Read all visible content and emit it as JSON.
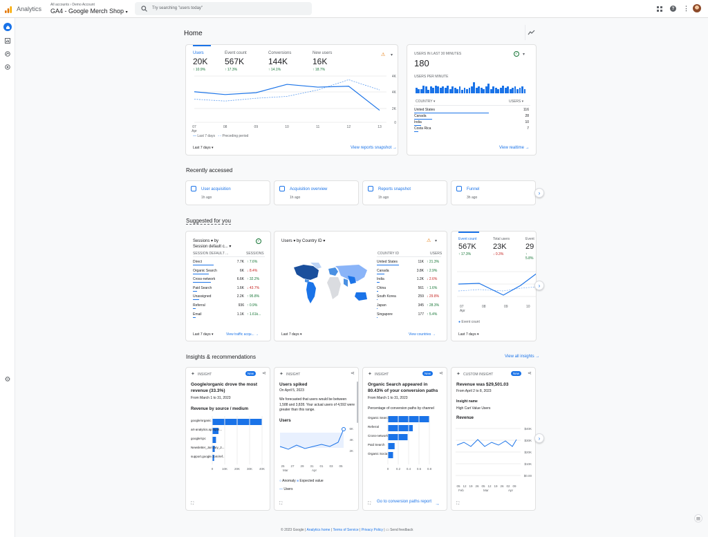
{
  "header": {
    "app": "Analytics",
    "breadcrumb": "All accounts › Demo Account",
    "property": "GA4 - Google Merch Shop",
    "search_placeholder": "Try searching \"users today\""
  },
  "page_title": "Home",
  "summary": {
    "metrics": [
      {
        "label": "Users",
        "value": "20K",
        "delta": "↑ 10.9%"
      },
      {
        "label": "Event count",
        "value": "567K",
        "delta": "↑ 17.3%"
      },
      {
        "label": "Conversions",
        "value": "144K",
        "delta": "↑ 14.1%"
      },
      {
        "label": "New users",
        "value": "16K",
        "delta": "↑ 18.7%"
      }
    ],
    "yticks": [
      "4K",
      "4K",
      "2K",
      "0"
    ],
    "xticks": [
      "07",
      "08",
      "09",
      "10",
      "11",
      "12",
      "13"
    ],
    "xsub": "Apr",
    "legend_current": "Last 7 days",
    "legend_previous": "Preceding period",
    "range": "Last 7 days",
    "link": "View reports snapshot",
    "chart_data": {
      "type": "line",
      "categories": [
        "07",
        "08",
        "09",
        "10",
        "11",
        "12",
        "13"
      ],
      "series": [
        {
          "name": "Last 7 days",
          "values": [
            3.3,
            3.0,
            3.2,
            4.1,
            3.8,
            3.9,
            1.3
          ]
        },
        {
          "name": "Preceding period",
          "values": [
            2.5,
            2.3,
            2.6,
            2.8,
            3.5,
            4.6,
            3.5
          ]
        }
      ],
      "ylim": [
        0,
        5
      ]
    }
  },
  "realtime": {
    "title": "USERS IN LAST 30 MINUTES",
    "value": "180",
    "sub": "USERS PER MINUTE",
    "col1": "COUNTRY ▾",
    "col2": "USERS ▾",
    "rows": [
      {
        "name": "United States",
        "value": "116",
        "share": 1
      },
      {
        "name": "Canada",
        "value": "28",
        "share": 0.24
      },
      {
        "name": "India",
        "value": "10",
        "share": 0.09
      },
      {
        "name": "Costa Rica",
        "value": "7",
        "share": 0.06
      }
    ],
    "link": "View realtime",
    "bars": [
      5,
      4,
      4,
      7,
      6,
      3,
      6,
      5,
      7,
      6,
      5,
      6,
      5,
      7,
      4,
      6,
      5,
      4,
      6,
      3,
      5,
      4,
      5,
      6,
      10,
      5,
      6,
      5,
      4,
      6,
      9,
      4,
      6,
      5,
      4,
      5,
      7,
      5,
      6,
      4,
      5,
      6,
      4,
      5,
      6,
      4
    ]
  },
  "recent": {
    "title": "Recently accessed",
    "items": [
      {
        "label": "User acquisition",
        "time": "1h ago"
      },
      {
        "label": "Acquisition overview",
        "time": "1h ago"
      },
      {
        "label": "Reports snapshot",
        "time": "1h ago"
      },
      {
        "label": "Funnel",
        "time": "3h ago"
      }
    ]
  },
  "suggested": {
    "title": "Suggested for you",
    "sessions": {
      "header1": "Sessions ▾",
      "header2": "by",
      "header3": "Session default c... ▾",
      "col1": "SESSION DEFAULT ...",
      "col2": "SESSIONS",
      "rows": [
        {
          "name": "Direct",
          "value": "7.7K",
          "delta": "↑ 7.6%",
          "share": 1
        },
        {
          "name": "Organic Search",
          "value": "6K",
          "delta": "↓ 8.4%",
          "share": 0.78
        },
        {
          "name": "Cross-network",
          "value": "6.6K",
          "delta": "↑ 32.2%",
          "share": 0.86
        },
        {
          "name": "Paid Search",
          "value": "1.6K",
          "delta": "↓ 43.7%",
          "share": 0.21
        },
        {
          "name": "Unassigned",
          "value": "2.2K",
          "delta": "↑ 95.8%",
          "share": 0.29
        },
        {
          "name": "Referral",
          "value": "936",
          "delta": "↑ 0.9%",
          "share": 0.12
        },
        {
          "name": "Email",
          "value": "1.1K",
          "delta": "↑ 1.61k...",
          "share": 0.14
        }
      ],
      "range": "Last 7 days",
      "link": "View traffic acqu..."
    },
    "country": {
      "header": "Users ▾ by Country ID ▾",
      "col1": "COUNTRY ID",
      "col2": "USERS",
      "rows": [
        {
          "name": "United States",
          "value": "11K",
          "delta": "↑ 21.3%",
          "share": 1
        },
        {
          "name": "Canada",
          "value": "3.8K",
          "delta": "↑ 2.9%",
          "share": 0.35
        },
        {
          "name": "India",
          "value": "1.2K",
          "delta": "↓ 2.6%",
          "share": 0.11
        },
        {
          "name": "China",
          "value": "561",
          "delta": "↑ 1.6%",
          "share": 0.05
        },
        {
          "name": "South Korea",
          "value": "259",
          "delta": "↓ 29.8%",
          "share": 0.03
        },
        {
          "name": "Japan",
          "value": "345",
          "delta": "↑ 28.3%",
          "share": 0.03
        },
        {
          "name": "Singapore",
          "value": "177",
          "delta": "↑ 5.4%",
          "share": 0.02
        }
      ],
      "range": "Last 7 days",
      "link": "View countries"
    },
    "events": {
      "metrics": [
        {
          "label": "Event count",
          "value": "567K",
          "delta": "↑ 17.3%"
        },
        {
          "label": "Total users",
          "value": "23K",
          "delta": "↓ 0.3%"
        },
        {
          "label": "Event",
          "value": "29",
          "delta": "↑ 5.8%"
        }
      ],
      "xticks": [
        "07",
        "08",
        "09",
        "10"
      ],
      "xsub": "Apr",
      "legend": "Event count",
      "range": "Last 7 days"
    }
  },
  "insights": {
    "title": "Insights & recommendations",
    "view_all": "View all insights",
    "cards": [
      {
        "tag": "INSIGHT",
        "new": "New",
        "headline": "Google/organic drove the most revenue (33.3%)",
        "date": "From March 1 to 31, 2023",
        "sub": "Revenue by source / medium",
        "labels": [
          "google/organic",
          "art-analytics.appspot...",
          "google/cpc",
          "Newsletter_January_2...",
          "support.google.com/ref..."
        ],
        "values": [
          40,
          5,
          3,
          2,
          1.5
        ],
        "xticks": [
          "0",
          "10K",
          "20K",
          "30K",
          "40K"
        ]
      },
      {
        "tag": "INSIGHT",
        "headline": "Users spiked",
        "date": "On April 5, 2023",
        "body": "We forecasted that users would be between 1,588 and 3,828. Your actual users of 4,592 were greater than this range.",
        "sub": "Users",
        "yticks": [
          "6K",
          "4K",
          "2K"
        ],
        "xticks": [
          "25",
          "27",
          "29",
          "31",
          "01",
          "03",
          "05"
        ],
        "xsub1": "Mar",
        "xsub2": "Apr",
        "legend1": "Anomaly",
        "legend2": "Expected value",
        "legend3": "Users"
      },
      {
        "tag": "INSIGHT",
        "new": "New",
        "headline": "Organic Search appeared in 80.43% of your conversion paths",
        "date": "From March 1 to 31, 2023",
        "sub": "Percentage of conversion paths by channel",
        "labels": [
          "Organic Search",
          "Referral",
          "Cross-network",
          "Paid Search",
          "Organic Social"
        ],
        "values": [
          0.8,
          0.48,
          0.38,
          0.13,
          0.1
        ],
        "xticks": [
          "0",
          "0.2",
          "0.4",
          "0.6",
          "0.8"
        ],
        "link": "Go to conversion paths report"
      },
      {
        "tag": "CUSTOM INSIGHT",
        "new": "New",
        "headline": "Revenue was $29,501.03",
        "date": "From April 2 to 8, 2023",
        "label": "Insight name",
        "value": "High Cart Value Users",
        "sub": "Revenue",
        "yticks": [
          "$40K",
          "$30K",
          "$20K",
          "$10K",
          "$0.00"
        ],
        "xticks": [
          "05",
          "12",
          "19",
          "26",
          "05",
          "12",
          "19",
          "26",
          "02",
          "09"
        ],
        "xsub1": "Feb",
        "xsub2": "Mar",
        "xsub3": "Apr"
      }
    ]
  },
  "footer": {
    "copyright": "© 2023 Google |",
    "links": [
      "Analytics home",
      "Terms of Service",
      "Privacy Policy"
    ],
    "feedback": "Send feedback"
  }
}
